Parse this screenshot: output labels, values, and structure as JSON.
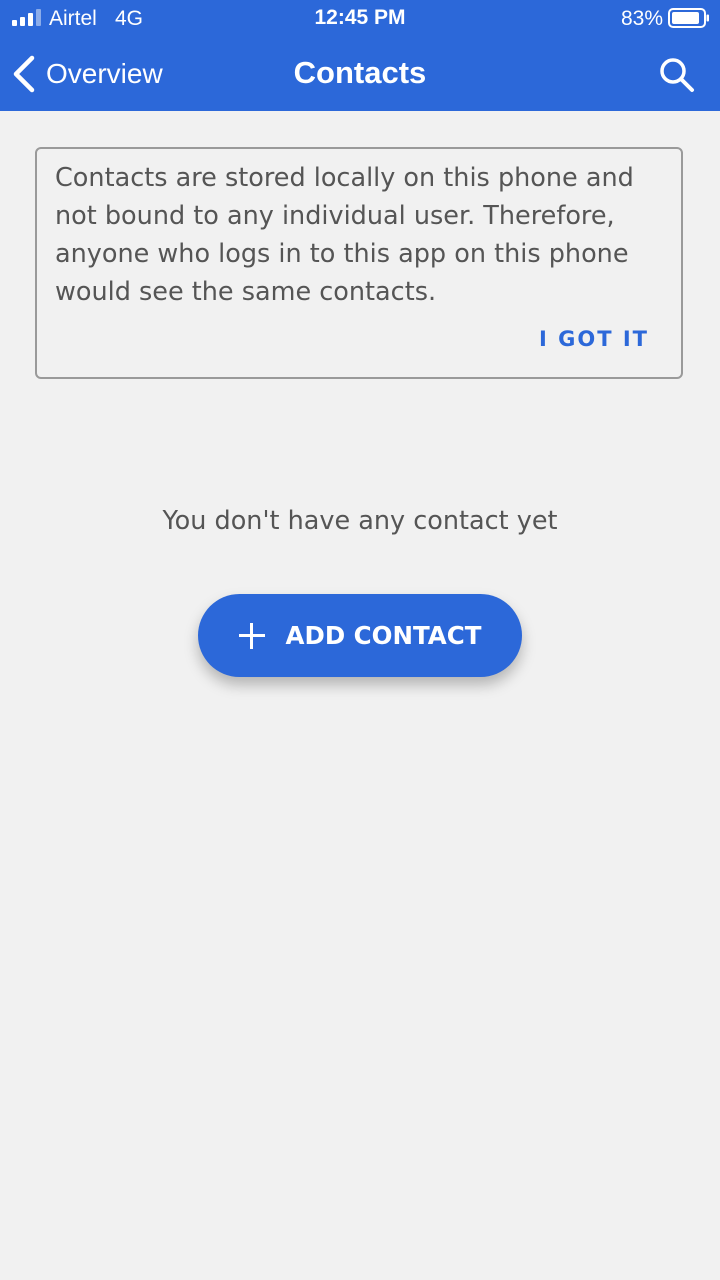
{
  "status_bar": {
    "carrier": "Airtel",
    "network": "4G",
    "time": "12:45 PM",
    "battery": "83%"
  },
  "nav": {
    "back_label": "Overview",
    "title": "Contacts"
  },
  "info_card": {
    "message": "Contacts are stored locally on this phone and not bound to any individual user. Therefore, anyone who logs in to this app on this phone would see the same contacts.",
    "dismiss_label": "I GOT IT"
  },
  "empty_state": {
    "message": "You don't have any contact yet",
    "add_button_label": "ADD CONTACT"
  },
  "colors": {
    "primary": "#2c68d9",
    "background": "#f1f1f1",
    "body_text": "#555555"
  },
  "icons": {
    "signal": "signal-bars-icon",
    "battery": "battery-icon",
    "back": "chevron-left-icon",
    "search": "search-icon",
    "add": "plus-icon"
  }
}
